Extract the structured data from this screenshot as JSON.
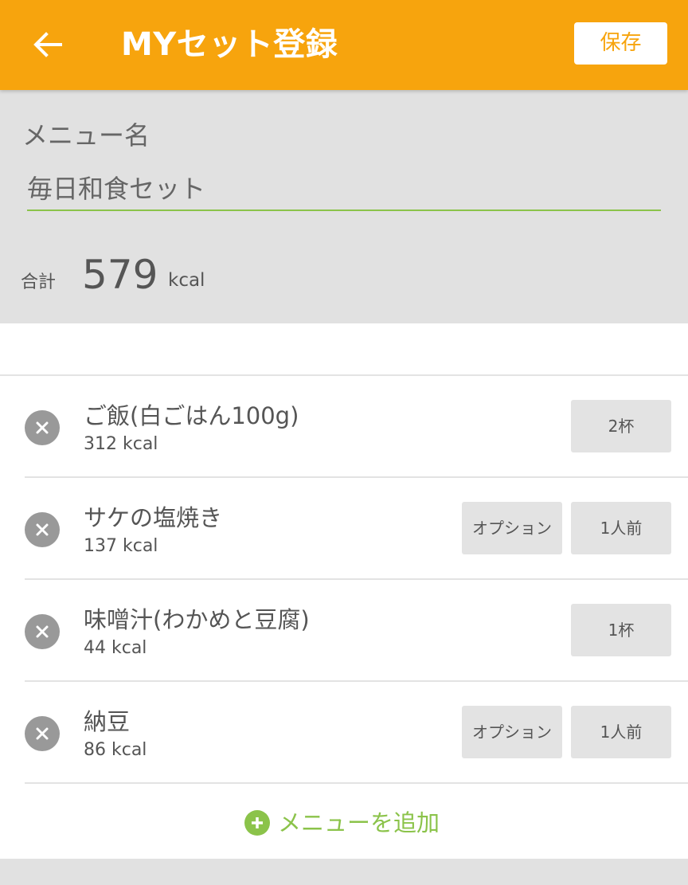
{
  "colors": {
    "header_bg": "#f7a40d",
    "accent_green": "#8bc34a",
    "form_bg": "#e1e1e1",
    "chip_bg": "#e3e3e3"
  },
  "header": {
    "back_icon": "arrow-left-icon",
    "title": "MYセット登録",
    "save_label": "保存"
  },
  "form": {
    "menu_name_label": "メニュー名",
    "menu_name_value": "毎日和食セット",
    "total_label": "合計",
    "total_value": "579",
    "total_unit": "kcal"
  },
  "items": [
    {
      "name": "ご飯(白ごはん100g)",
      "kcal": "312 kcal",
      "option": null,
      "quantity": "2杯"
    },
    {
      "name": "サケの塩焼き",
      "kcal": "137 kcal",
      "option": "オプション",
      "quantity": "1人前"
    },
    {
      "name": "味噌汁(わかめと豆腐)",
      "kcal": "44 kcal",
      "option": null,
      "quantity": "1杯"
    },
    {
      "name": "納豆",
      "kcal": "86 kcal",
      "option": "オプション",
      "quantity": "1人前"
    }
  ],
  "add_menu": {
    "icon": "plus-circle-icon",
    "label": "メニューを追加"
  }
}
